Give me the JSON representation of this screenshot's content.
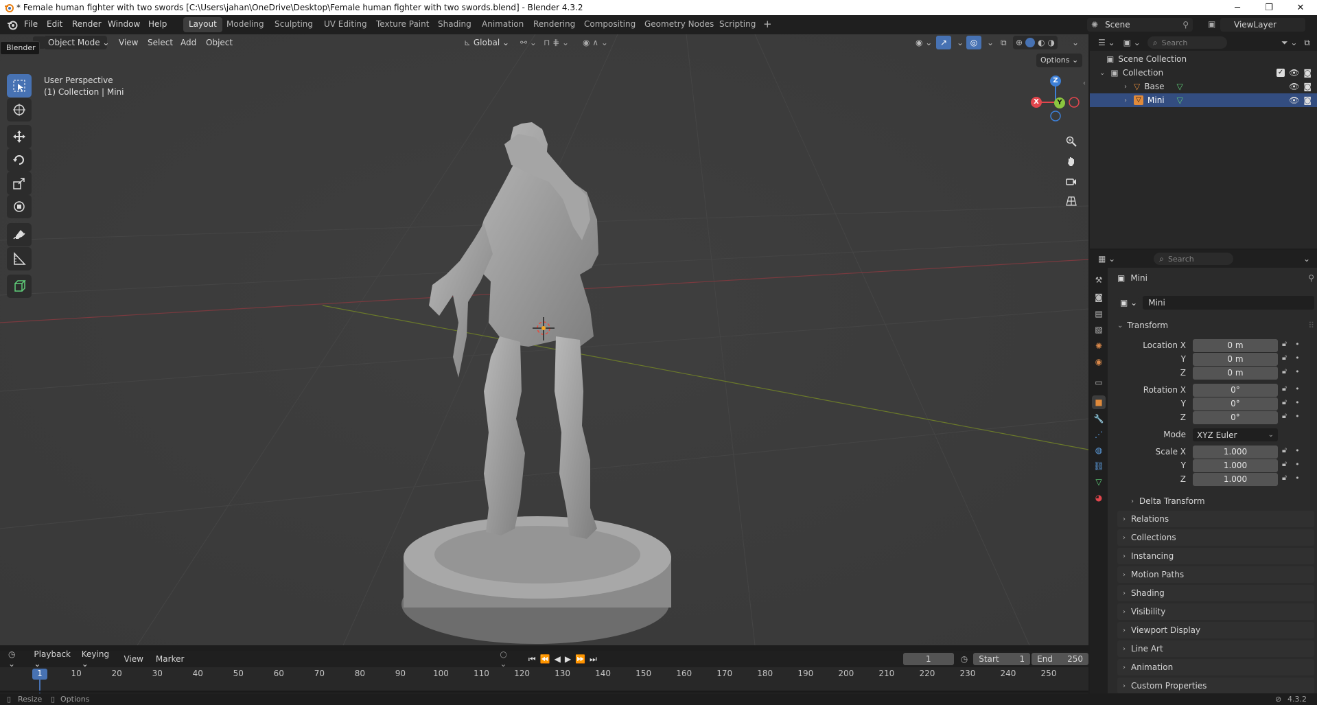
{
  "window": {
    "title": "* Female human fighter with two swords [C:\\Users\\jahan\\OneDrive\\Desktop\\Female human fighter with two swords.blend] - Blender 4.3.2",
    "minimize": "─",
    "maximize": "❐",
    "close": "✕"
  },
  "menubar": {
    "items": [
      "File",
      "Edit",
      "Render",
      "Window",
      "Help"
    ],
    "workspaces": [
      "Layout",
      "Modeling",
      "Sculpting",
      "UV Editing",
      "Texture Paint",
      "Shading",
      "Animation",
      "Rendering",
      "Compositing",
      "Geometry Nodes",
      "Scripting"
    ],
    "add_workspace": "+",
    "scene": "Scene",
    "view_layer": "ViewLayer"
  },
  "viewport": {
    "tooltip": "Blender",
    "mode": "Object Mode",
    "menus": [
      "View",
      "Select",
      "Add",
      "Object"
    ],
    "transform_orientation": "Global",
    "options": "Options",
    "perspective": "User Perspective",
    "collection_info": "(1) Collection | Mini",
    "gizmo": {
      "x": "X",
      "y": "Y",
      "z": "Z"
    }
  },
  "outliner": {
    "search_placeholder": "Search",
    "scene_collection": "Scene Collection",
    "collection": "Collection",
    "objects": [
      "Base",
      "Mini"
    ]
  },
  "properties": {
    "search_placeholder": "Search",
    "object_name": "Mini",
    "object_field": "Mini",
    "transform_header": "Transform",
    "location": {
      "label_x": "Location X",
      "label_y": "Y",
      "label_z": "Z",
      "x": "0 m",
      "y": "0 m",
      "z": "0 m"
    },
    "rotation": {
      "label_x": "Rotation X",
      "label_y": "Y",
      "label_z": "Z",
      "x": "0°",
      "y": "0°",
      "z": "0°"
    },
    "mode_label": "Mode",
    "mode_value": "XYZ Euler",
    "scale": {
      "label_x": "Scale X",
      "label_y": "Y",
      "label_z": "Z",
      "x": "1.000",
      "y": "1.000",
      "z": "1.000"
    },
    "delta_transform": "Delta Transform",
    "panels": [
      "Relations",
      "Collections",
      "Instancing",
      "Motion Paths",
      "Shading",
      "Visibility",
      "Viewport Display",
      "Line Art",
      "Animation",
      "Custom Properties"
    ]
  },
  "timeline": {
    "menus": [
      "Playback",
      "Keying",
      "View",
      "Marker"
    ],
    "current_frame": "1",
    "start_label": "Start",
    "start": "1",
    "end_label": "End",
    "end": "250",
    "ticks": [
      "1",
      "10",
      "20",
      "30",
      "40",
      "50",
      "60",
      "70",
      "80",
      "90",
      "100",
      "110",
      "120",
      "130",
      "140",
      "150",
      "160",
      "170",
      "180",
      "190",
      "200",
      "210",
      "220",
      "230",
      "240",
      "250"
    ]
  },
  "statusbar": {
    "left1": "Resize",
    "left2": "Options",
    "version": "4.3.2"
  },
  "colors": {
    "accent": "#4772b3",
    "axis_x": "#e2464d",
    "axis_y": "#8bc53f",
    "axis_z": "#3d7fd6",
    "object_orange": "#e08a3b",
    "mesh_green": "#5fcf7a"
  }
}
